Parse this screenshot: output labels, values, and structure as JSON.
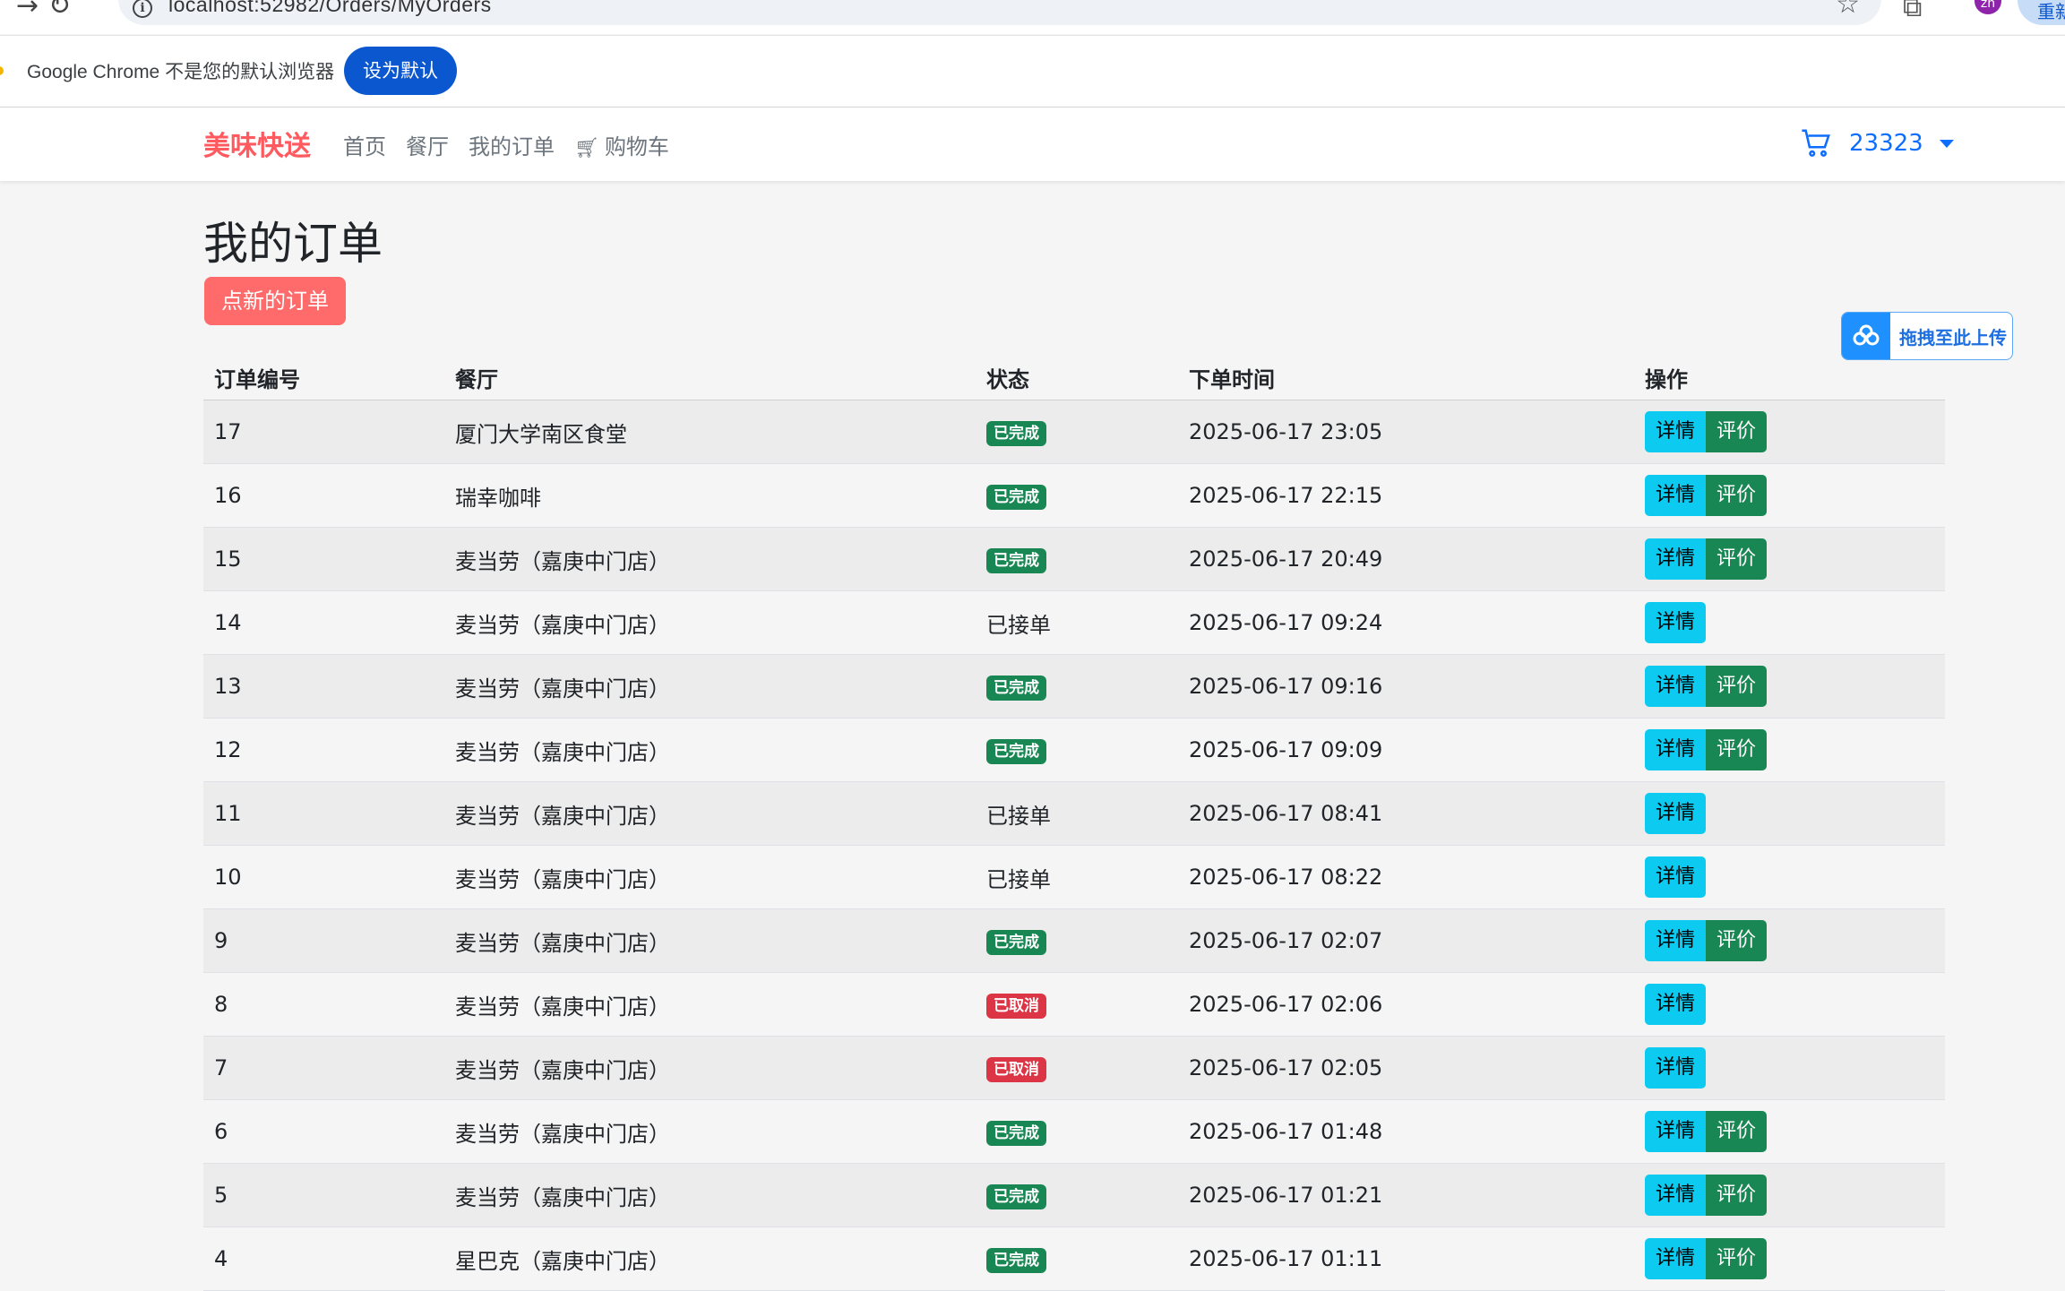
{
  "browser": {
    "url": "localhost:52982/Orders/MyOrders",
    "profile_initials": "zh",
    "update_label": "重新"
  },
  "infobar": {
    "message": "Google Chrome 不是您的默认浏览器",
    "button_label": "设为默认"
  },
  "navbar": {
    "brand": "美味快送",
    "links": [
      "首页",
      "餐厅",
      "我的订单",
      "购物车"
    ],
    "username": "23323"
  },
  "page": {
    "title": "我的订单",
    "new_order_label": "点新的订单",
    "upload_label": "拖拽至此上传"
  },
  "table": {
    "headers": [
      "订单编号",
      "餐厅",
      "状态",
      "下单时间",
      "操作"
    ],
    "detail_label": "详情",
    "review_label": "评价",
    "rows": [
      {
        "id": "17",
        "restaurant": "厦门大学南区食堂",
        "status": "已完成",
        "status_type": "done",
        "time": "2025-06-17 23:05",
        "reviewable": true
      },
      {
        "id": "16",
        "restaurant": "瑞幸咖啡",
        "status": "已完成",
        "status_type": "done",
        "time": "2025-06-17 22:15",
        "reviewable": true
      },
      {
        "id": "15",
        "restaurant": "麦当劳（嘉庚中门店）",
        "status": "已完成",
        "status_type": "done",
        "time": "2025-06-17 20:49",
        "reviewable": true
      },
      {
        "id": "14",
        "restaurant": "麦当劳（嘉庚中门店）",
        "status": "已接单",
        "status_type": "text",
        "time": "2025-06-17 09:24",
        "reviewable": false
      },
      {
        "id": "13",
        "restaurant": "麦当劳（嘉庚中门店）",
        "status": "已完成",
        "status_type": "done",
        "time": "2025-06-17 09:16",
        "reviewable": true
      },
      {
        "id": "12",
        "restaurant": "麦当劳（嘉庚中门店）",
        "status": "已完成",
        "status_type": "done",
        "time": "2025-06-17 09:09",
        "reviewable": true
      },
      {
        "id": "11",
        "restaurant": "麦当劳（嘉庚中门店）",
        "status": "已接单",
        "status_type": "text",
        "time": "2025-06-17 08:41",
        "reviewable": false
      },
      {
        "id": "10",
        "restaurant": "麦当劳（嘉庚中门店）",
        "status": "已接单",
        "status_type": "text",
        "time": "2025-06-17 08:22",
        "reviewable": false
      },
      {
        "id": "9",
        "restaurant": "麦当劳（嘉庚中门店）",
        "status": "已完成",
        "status_type": "done",
        "time": "2025-06-17 02:07",
        "reviewable": true
      },
      {
        "id": "8",
        "restaurant": "麦当劳（嘉庚中门店）",
        "status": "已取消",
        "status_type": "cancel",
        "time": "2025-06-17 02:06",
        "reviewable": false
      },
      {
        "id": "7",
        "restaurant": "麦当劳（嘉庚中门店）",
        "status": "已取消",
        "status_type": "cancel",
        "time": "2025-06-17 02:05",
        "reviewable": false
      },
      {
        "id": "6",
        "restaurant": "麦当劳（嘉庚中门店）",
        "status": "已完成",
        "status_type": "done",
        "time": "2025-06-17 01:48",
        "reviewable": true
      },
      {
        "id": "5",
        "restaurant": "麦当劳（嘉庚中门店）",
        "status": "已完成",
        "status_type": "done",
        "time": "2025-06-17 01:21",
        "reviewable": true
      },
      {
        "id": "4",
        "restaurant": "星巴克（嘉庚中门店）",
        "status": "已完成",
        "status_type": "done",
        "time": "2025-06-17 01:11",
        "reviewable": true
      }
    ]
  },
  "colors": {
    "brand": "#ff5a5f",
    "primary": "#0d6efd",
    "success": "#198754",
    "danger": "#dc3545",
    "info": "#0dcaf0"
  },
  "icons": [
    "back-arrow-icon",
    "reload-icon",
    "info-icon",
    "bookmark-star-icon",
    "extensions-icon",
    "cart-icon",
    "cloud-upload-icon",
    "caret-down-icon"
  ]
}
